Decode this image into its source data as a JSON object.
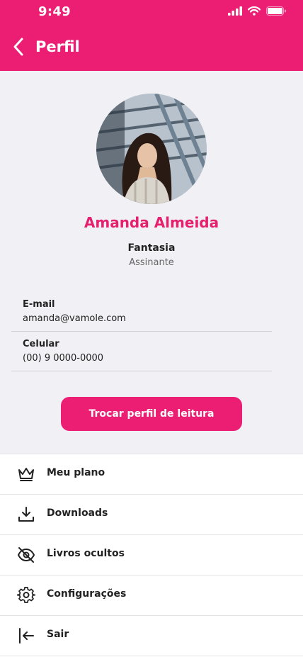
{
  "status_bar": {
    "time": "9:49"
  },
  "header": {
    "title": "Perfil"
  },
  "profile": {
    "name": "Amanda Almeida",
    "kind": "Fantasia",
    "role": "Assinante"
  },
  "contact": {
    "email_label": "E-mail",
    "email_value": "amanda@vamole.com",
    "phone_label": "Celular",
    "phone_value": "(00) 9 0000-0000"
  },
  "cta": {
    "label": "Trocar perfil de leitura"
  },
  "menu": {
    "items": [
      {
        "label": "Meu plano",
        "icon": "crown-icon"
      },
      {
        "label": "Downloads",
        "icon": "download-icon"
      },
      {
        "label": "Livros ocultos",
        "icon": "eye-off-icon"
      },
      {
        "label": "Configurações",
        "icon": "gear-icon"
      },
      {
        "label": "Sair",
        "icon": "logout-icon"
      }
    ]
  },
  "colors": {
    "brand": "#EC1E74",
    "name_text": "#E5206F",
    "background": "#F1F1F5"
  }
}
